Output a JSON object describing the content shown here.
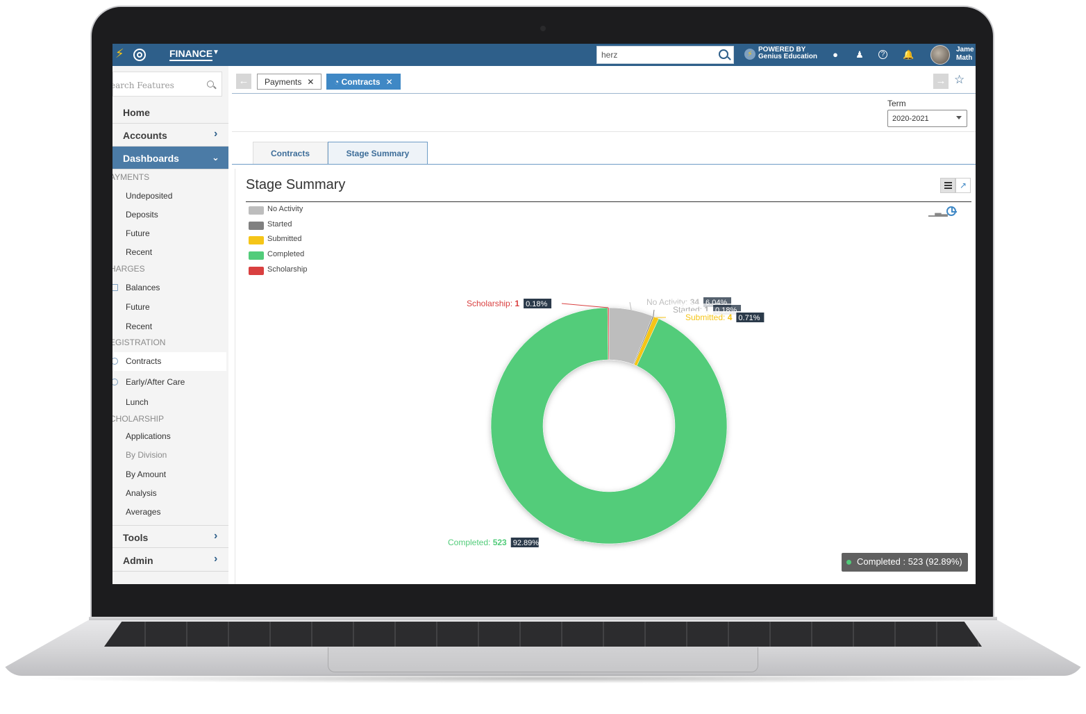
{
  "topbar": {
    "module": "FINANCE",
    "search_value": "herz",
    "powered_line1": "POWERED BY",
    "powered_line2": "Genius Education",
    "user_line1": "Jame",
    "user_line2": "Math"
  },
  "sidebar": {
    "search_placeholder": "earch Features",
    "home": "Home",
    "accounts": "Accounts",
    "dashboards": "Dashboards",
    "sections": {
      "payments": "AYMENTS",
      "charges": "HARGES",
      "registration": "EGISTRATION",
      "scholarship": "CHOLARSHIP"
    },
    "payments_items": [
      "Undeposited",
      "Deposits",
      "Future",
      "Recent"
    ],
    "charges_items": [
      "Balances",
      "Future",
      "Recent"
    ],
    "registration_items": [
      "Contracts",
      "Early/After Care",
      "Lunch"
    ],
    "scholarship_items": [
      "Applications",
      "By Division",
      "By Amount",
      "Analysis",
      "Averages"
    ],
    "tools": "Tools",
    "admin": "Admin"
  },
  "tabs": {
    "payments": "Payments",
    "contracts": "Contracts"
  },
  "term": {
    "label": "Term",
    "value": "2020-2021"
  },
  "subtabs": {
    "contracts": "Contracts",
    "stage_summary": "Stage Summary"
  },
  "panel": {
    "title": "Stage Summary"
  },
  "colors": {
    "no_activity": "#bdbdbd",
    "started": "#808080",
    "submitted": "#f5c518",
    "completed": "#52cc7a",
    "scholarship": "#d94040"
  },
  "chart_data": {
    "type": "pie",
    "donut": true,
    "legend_position": "top-left",
    "series": [
      {
        "name": "No Activity",
        "value": 34,
        "percent": "6.04%",
        "color": "#bdbdbd",
        "label": "No Activity"
      },
      {
        "name": "Started",
        "value": 1,
        "percent": "0.18%",
        "color": "#808080",
        "label": "Started"
      },
      {
        "name": "Submitted",
        "value": 4,
        "percent": "0.71%",
        "color": "#f5c518",
        "label": "Submitted"
      },
      {
        "name": "Completed",
        "value": 523,
        "percent": "92.89%",
        "color": "#52cc7a",
        "label": "Completed"
      },
      {
        "name": "Scholarship",
        "value": 1,
        "percent": "0.18%",
        "color": "#d94040",
        "label": "Scholarship"
      }
    ],
    "tooltip": "Completed : 523 (92.89%)"
  }
}
